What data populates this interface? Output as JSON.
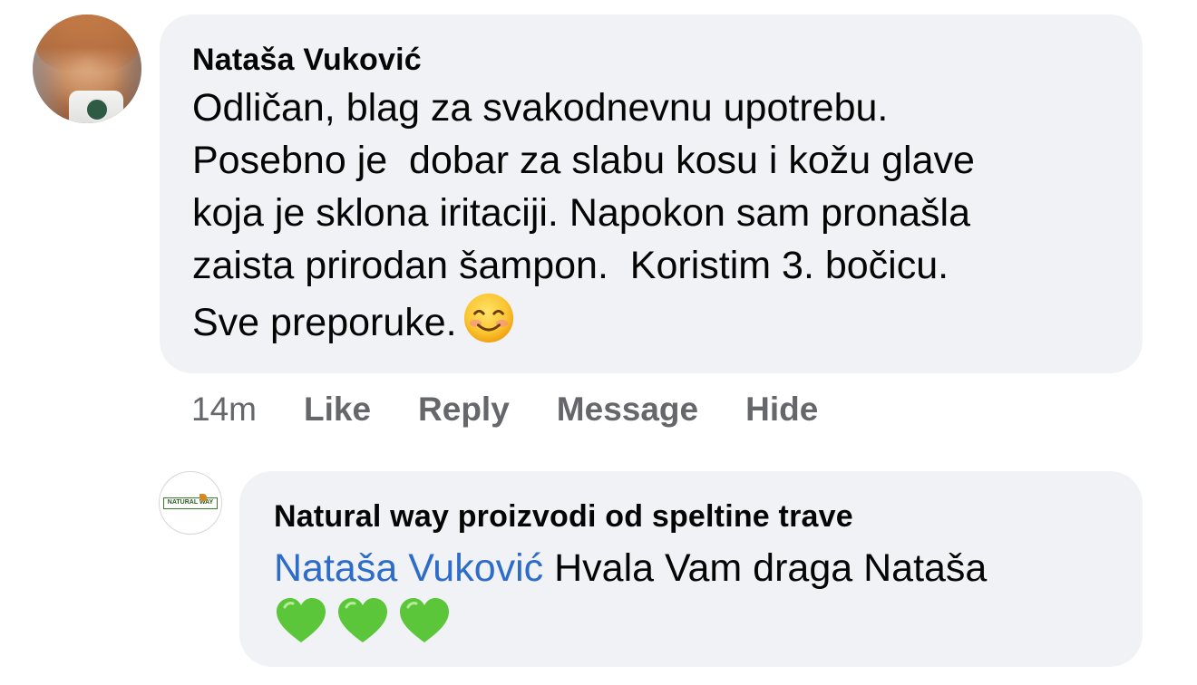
{
  "comment": {
    "author": "Nataša Vuković",
    "text": "Odličan, blag za svakodnevnu upotrebu. Posebno je  dobar za slabu kosu i kožu glave koja je sklona iritaciji. Napokon sam pronašla zaista prirodan šampon.  Koristim 3. bočicu. Sve preporuke.",
    "lines": [
      "Odličan, blag za svakodnevnu upotrebu.",
      "Posebno je  dobar za slabu kosu i kožu glave",
      "koja je sklona iritaciji. Napokon sam pronašla",
      "zaista prirodan šampon.  Koristim 3. bočicu.",
      "Sve preporuke."
    ],
    "emoji": "smiling-face-icon",
    "timestamp": "14m",
    "actions": {
      "like": "Like",
      "reply": "Reply",
      "message": "Message",
      "hide": "Hide"
    }
  },
  "reply": {
    "author": "Natural way proizvodi od speltine trave",
    "avatar_logo_text": "NATURAL WAY",
    "mention": "Nataša Vuković",
    "text": " Hvala Vam draga Nataša",
    "emojis": [
      "green-heart-icon",
      "green-heart-icon",
      "green-heart-icon"
    ]
  },
  "colors": {
    "bubble_bg": "#f0f2f5",
    "mention": "#2d6cc9",
    "meta_text": "#65676b",
    "heart_green": "#5cc63a"
  }
}
